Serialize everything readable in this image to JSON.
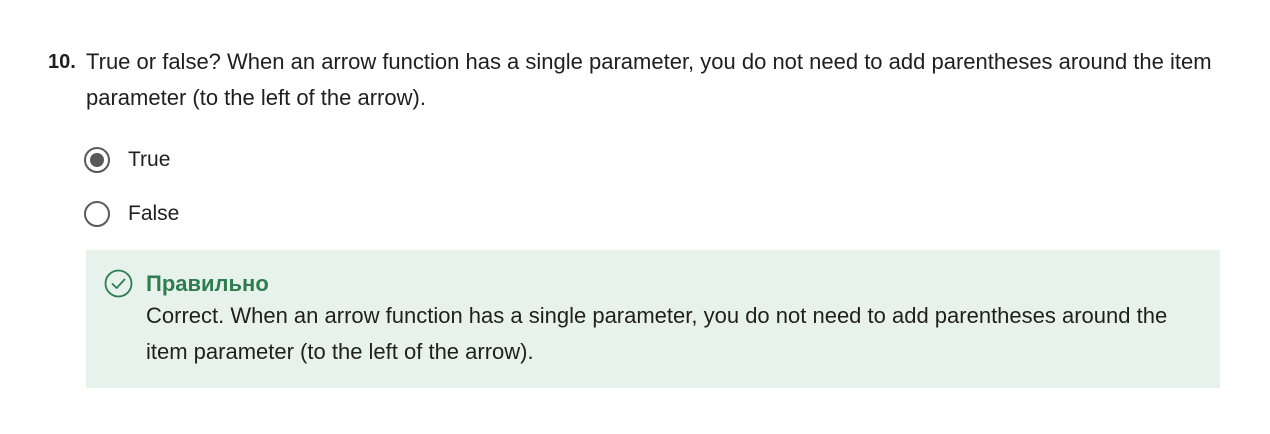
{
  "question": {
    "number": "10.",
    "text": "True or false? When an arrow function has a single parameter, you do not need to add parentheses around the item parameter (to the left of the arrow)."
  },
  "options": [
    {
      "label": "True",
      "selected": true
    },
    {
      "label": "False",
      "selected": false
    }
  ],
  "feedback": {
    "status": "Правильно",
    "message": "Correct. When an arrow function has a single parameter, you do not need to add parentheses around the item parameter (to the left of the arrow).",
    "icon": "check-circle-icon",
    "colors": {
      "accent": "#2e7d4f",
      "background": "#e8f2ec"
    }
  }
}
